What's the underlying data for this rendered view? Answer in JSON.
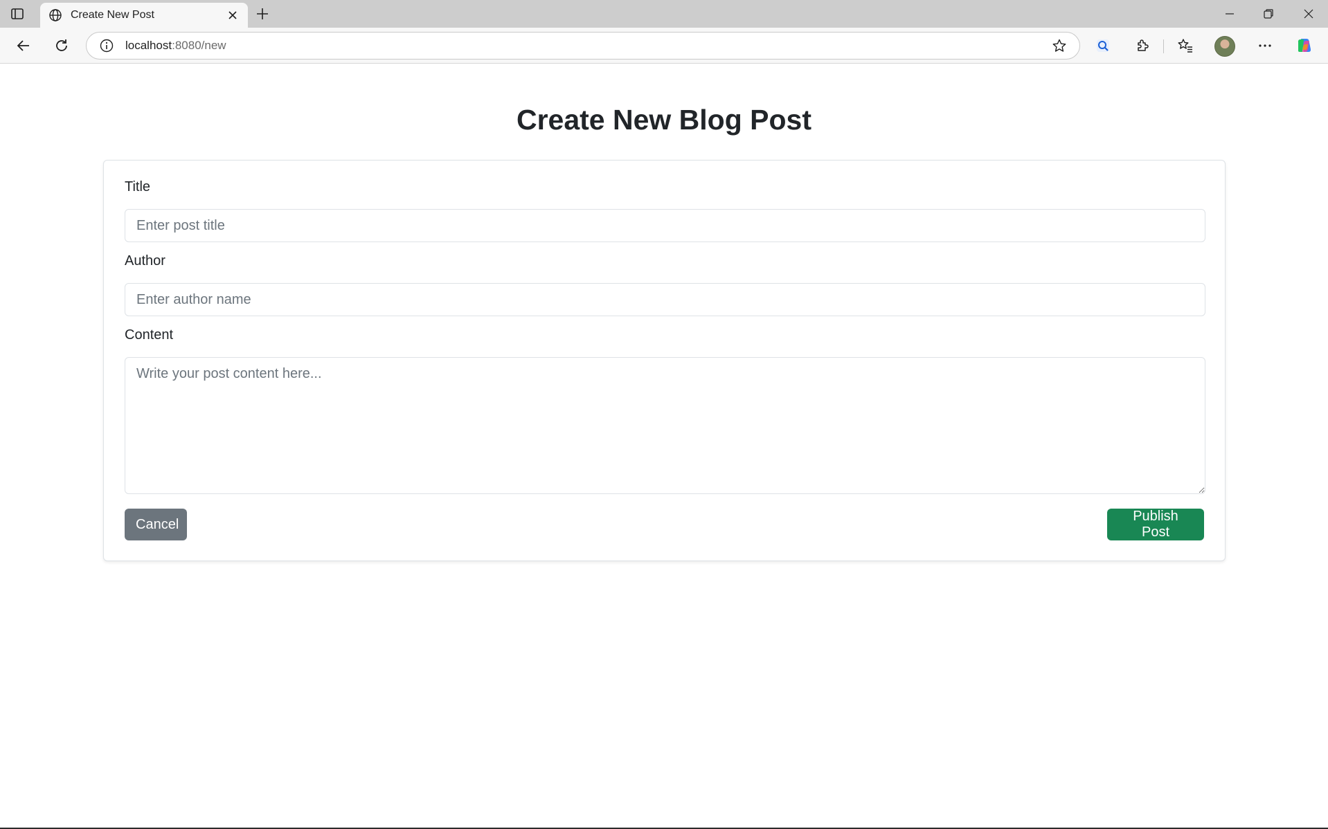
{
  "browser": {
    "tab_title": "Create New Post",
    "url_host": "localhost",
    "url_rest": ":8080/new"
  },
  "page": {
    "heading": "Create New Blog Post"
  },
  "form": {
    "title_label": "Title",
    "title_placeholder": "Enter post title",
    "title_value": "",
    "author_label": "Author",
    "author_placeholder": "Enter author name",
    "author_value": "",
    "content_label": "Content",
    "content_placeholder": "Write your post content here...",
    "content_value": "",
    "cancel_label": "Cancel",
    "publish_label": "Publish Post"
  },
  "colors": {
    "cancel_button": "#6c757d",
    "publish_button": "#198754",
    "heading_text": "#212529"
  },
  "icons": {
    "tab_actions": "tab-actions-icon",
    "tab_favicon": "globe-icon",
    "tab_close": "close-icon",
    "new_tab": "plus-icon",
    "minimize": "minimize-icon",
    "restore": "restore-icon",
    "close_window": "close-icon",
    "back": "back-arrow-icon",
    "reload": "reload-icon",
    "site_info": "info-icon",
    "favorite": "star-icon",
    "search_lens": "search-lens-icon",
    "extensions": "puzzle-icon",
    "favorites": "favorites-icon",
    "more": "more-dots-icon",
    "copilot": "copilot-icon"
  }
}
